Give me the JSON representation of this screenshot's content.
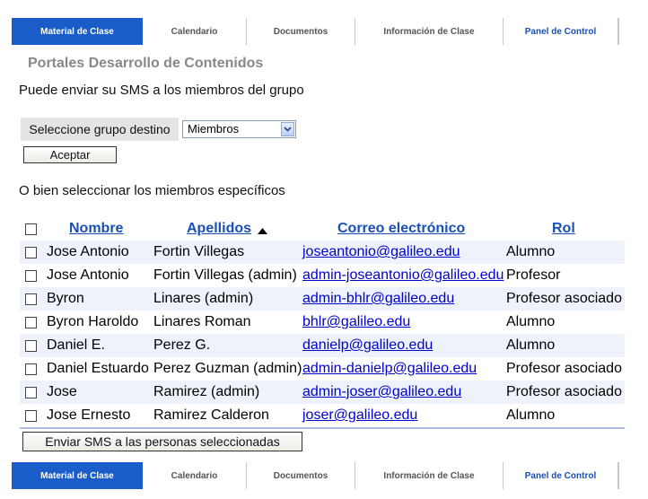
{
  "nav": {
    "tabs": [
      {
        "label": "Material de Clase",
        "active": true
      },
      {
        "label": "Calendario"
      },
      {
        "label": "Documentos"
      },
      {
        "label": "Información de Clase"
      },
      {
        "label": "Panel de Control"
      }
    ]
  },
  "page": {
    "title": "Portales Desarrollo de Contenidos",
    "intro": "Puede enviar su SMS a los miembros del grupo",
    "group_label": "Seleccione grupo destino",
    "group_select_value": "Miembros",
    "accept_label": "Aceptar",
    "or_text": "O bien seleccionar los miembros específicos",
    "send_label": "Enviar SMS a las personas seleccionadas"
  },
  "table": {
    "headers": {
      "nombre": "Nombre",
      "apellidos": "Apellidos",
      "correo": "Correo electrónico",
      "rol": "Rol"
    },
    "rows": [
      {
        "nombre": "Jose Antonio",
        "apellidos": "Fortin Villegas",
        "correo": "joseantonio@galileo.edu",
        "rol": "Alumno"
      },
      {
        "nombre": "Jose Antonio",
        "apellidos": "Fortin Villegas (admin)",
        "correo": "admin-joseantonio@galileo.edu",
        "rol": "Profesor"
      },
      {
        "nombre": "Byron",
        "apellidos": "Linares (admin)",
        "correo": "admin-bhlr@galileo.edu",
        "rol": "Profesor asociado"
      },
      {
        "nombre": "Byron Haroldo",
        "apellidos": "Linares Roman",
        "correo": "bhlr@galileo.edu",
        "rol": "Alumno"
      },
      {
        "nombre": "Daniel E.",
        "apellidos": "Perez G.",
        "correo": "danielp@galileo.edu",
        "rol": "Alumno"
      },
      {
        "nombre": "Daniel Estuardo",
        "apellidos": "Perez Guzman (admin)",
        "correo": "admin-danielp@galileo.edu",
        "rol": "Profesor asociado"
      },
      {
        "nombre": "Jose",
        "apellidos": "Ramirez (admin)",
        "correo": "admin-joser@galileo.edu",
        "rol": "Profesor asociado"
      },
      {
        "nombre": "Jose Ernesto",
        "apellidos": "Ramirez Calderon",
        "correo": "joser@galileo.edu",
        "rol": "Alumno"
      }
    ]
  },
  "colors": {
    "accent": "#1a5cc8",
    "link": "#0000cc",
    "row_alt": "#eef2fb"
  },
  "icons": {
    "sort": "sort-ascending-icon",
    "dropdown": "chevron-down-icon"
  }
}
